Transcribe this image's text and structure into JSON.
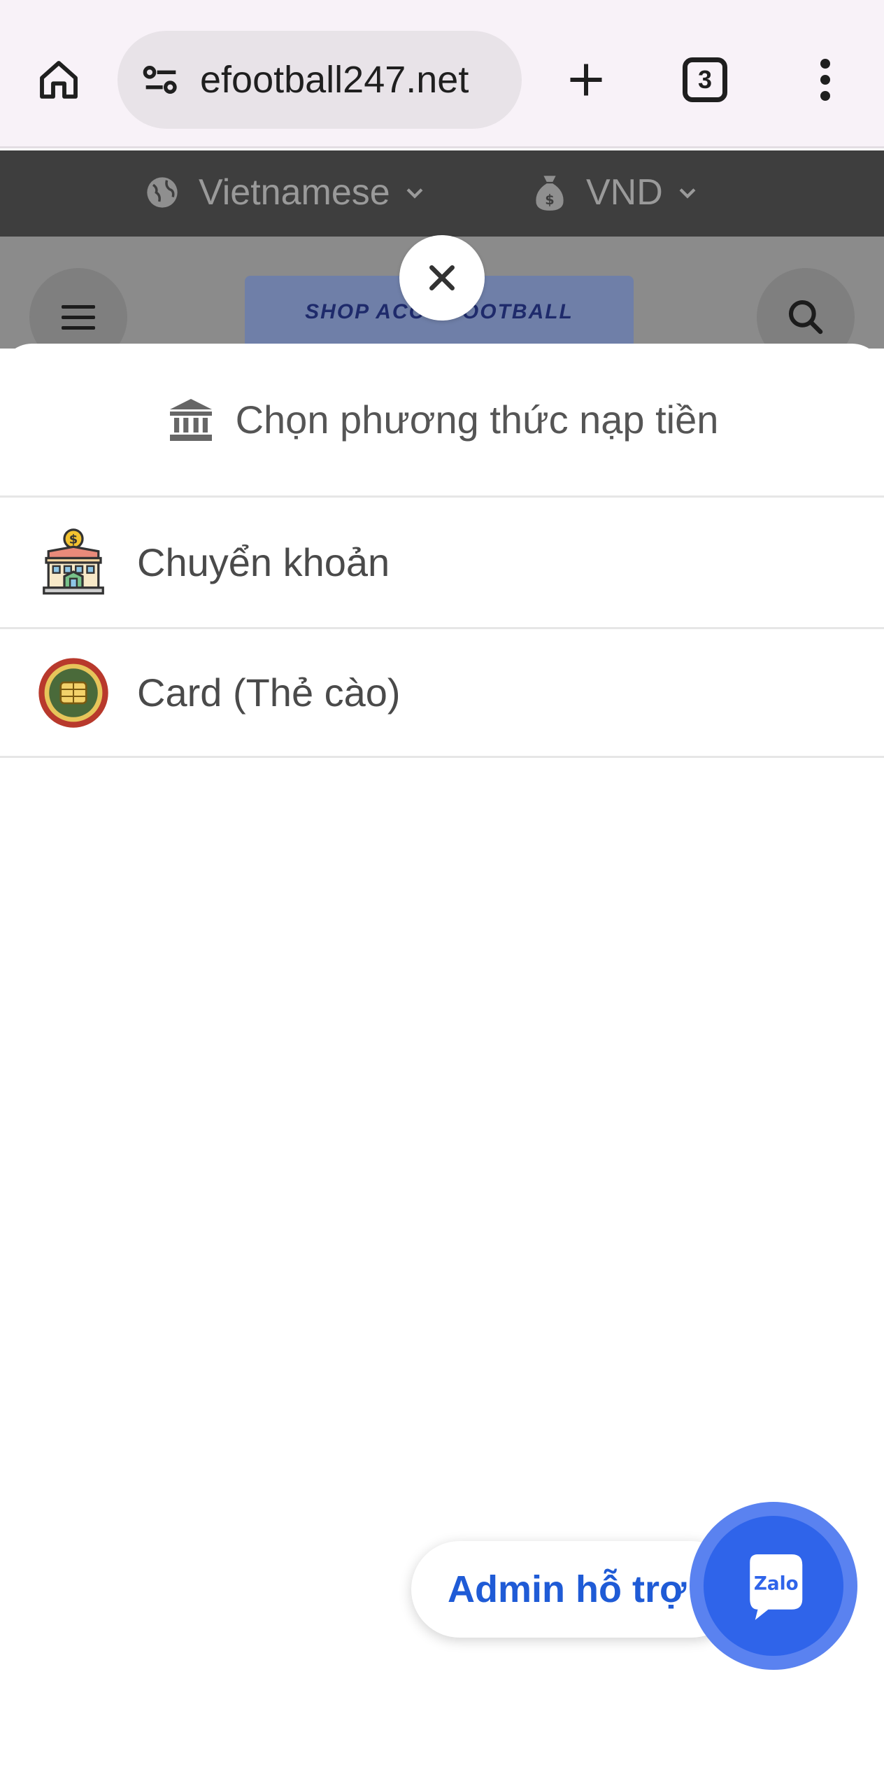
{
  "browser": {
    "url": "efootball247.net",
    "tab_count": "3"
  },
  "site": {
    "language": "Vietnamese",
    "currency": "VND",
    "logo_text": "SHOP ACC EFOOTBALL"
  },
  "modal": {
    "title": "Chọn phương thức nạp tiền",
    "options": [
      {
        "label": "Chuyển khoản",
        "icon": "bank-building-icon"
      },
      {
        "label": "Card (Thẻ cào)",
        "icon": "chip-card-icon"
      }
    ]
  },
  "support": {
    "label": "Admin hỗ trợ",
    "zalo_text": "Zalo"
  },
  "colors": {
    "accent_blue": "#1f5bd6",
    "zalo_blue": "#2f64ea",
    "overlay_dark": "#3e3e3e"
  }
}
